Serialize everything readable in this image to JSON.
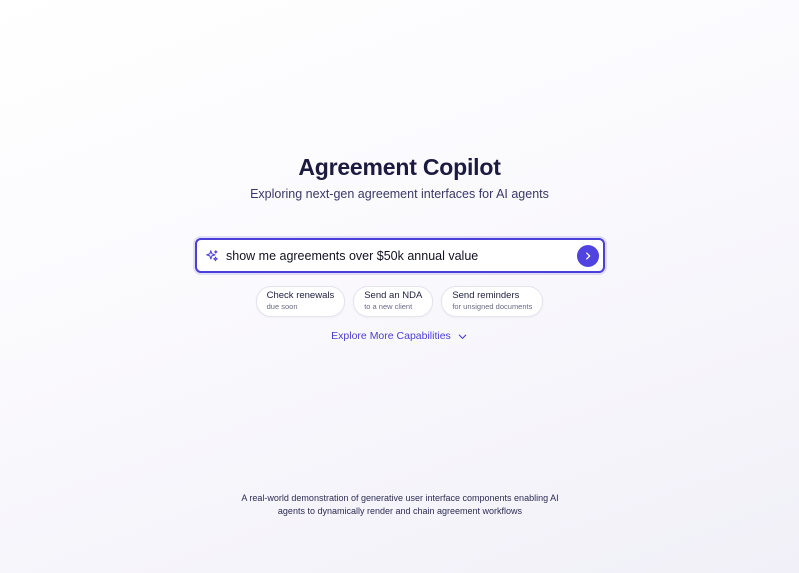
{
  "header": {
    "title": "Agreement Copilot",
    "subtitle": "Exploring next-gen agreement interfaces for AI agents"
  },
  "search": {
    "value": "show me agreements over $50k annual value",
    "icon": "sparkle-icon",
    "submit_icon": "chevron-right-icon",
    "accent_color": "#4b3fd9"
  },
  "suggestions": [
    {
      "title": "Check renewals",
      "subtitle": "due soon"
    },
    {
      "title": "Send an NDA",
      "subtitle": "to a new client"
    },
    {
      "title": "Send reminders",
      "subtitle": "for unsigned documents"
    }
  ],
  "explore": {
    "label": "Explore More Capabilities",
    "icon": "chevron-down-icon"
  },
  "footer": {
    "text": "A real-world demonstration of generative user interface components enabling AI agents to dynamically render and chain agreement workflows"
  }
}
